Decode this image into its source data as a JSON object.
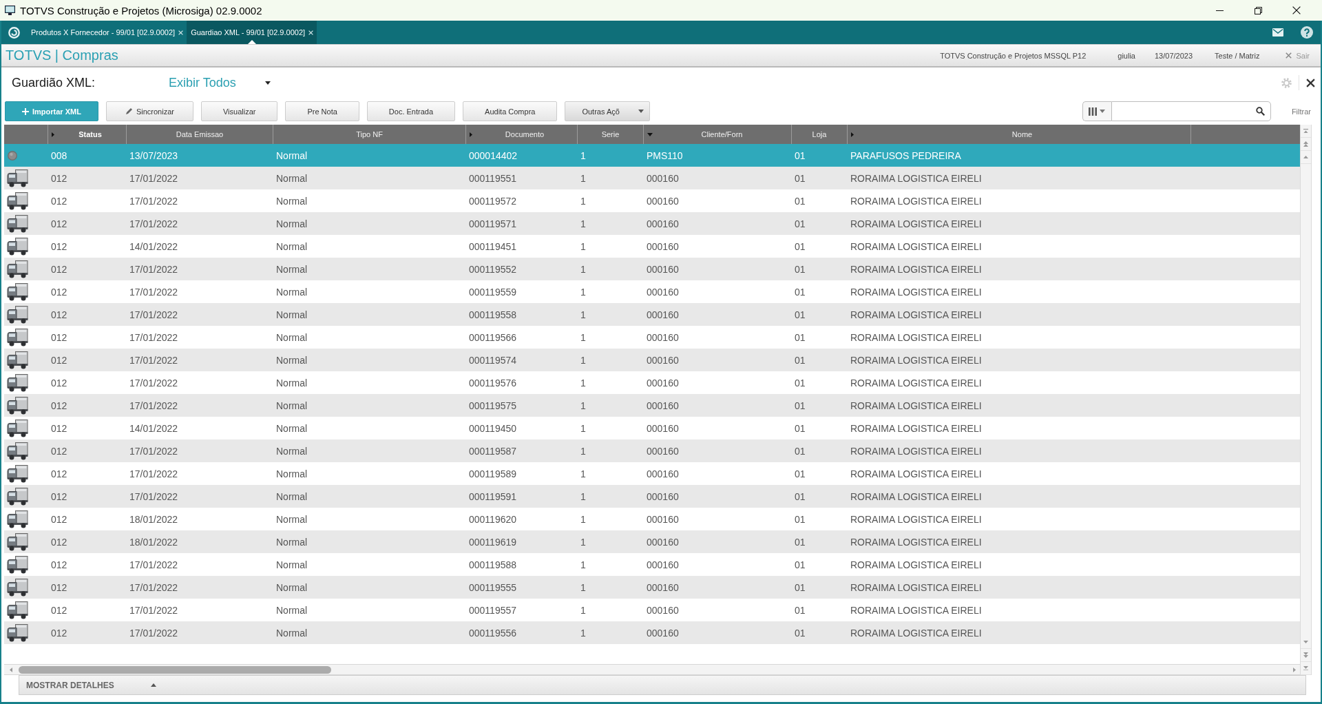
{
  "window": {
    "title": "TOTVS Construção e Projetos (Microsiga) 02.9.0002"
  },
  "tabs": [
    {
      "label": "Produtos X Fornecedor - 99/01 [02.9.0002]",
      "selected": false
    },
    {
      "label": "Guardiao XML - 99/01 [02.9.0002]",
      "selected": true
    }
  ],
  "header": {
    "brand": "TOTVS | Compras",
    "environment": "TOTVS Construção e Projetos MSSQL P12",
    "user": "giulia",
    "date": "13/07/2023",
    "branch": "Teste / Matriz",
    "exit": "Sair"
  },
  "page": {
    "title": "Guardião XML:",
    "view_filter": "Exibir Todos"
  },
  "toolbar": {
    "buttons": [
      {
        "label": "Importar XML",
        "kind": "primary"
      },
      {
        "label": "Sincronizar",
        "kind": "edit"
      },
      {
        "label": "Visualizar",
        "kind": "plain"
      },
      {
        "label": "Pre Nota",
        "kind": "plain"
      },
      {
        "label": "Doc. Entrada",
        "kind": "plain"
      },
      {
        "label": "Audita Compra",
        "kind": "plain"
      },
      {
        "label": "Outras Açõ",
        "kind": "menu"
      }
    ]
  },
  "search": {
    "filter_label": "Filtrar"
  },
  "table": {
    "columns": [
      {
        "label": "Status",
        "indexed": true,
        "sorted": false,
        "selected": true
      },
      {
        "label": "Data Emissao",
        "indexed": false,
        "sorted": false,
        "selected": false
      },
      {
        "label": "Tipo NF",
        "indexed": false,
        "sorted": false,
        "selected": false
      },
      {
        "label": "Documento",
        "indexed": true,
        "sorted": false,
        "selected": false
      },
      {
        "label": "Serie",
        "indexed": false,
        "sorted": false,
        "selected": false
      },
      {
        "label": "Cliente/Forn",
        "indexed": false,
        "sorted": true,
        "selected": false
      },
      {
        "label": "Loja",
        "indexed": false,
        "sorted": false,
        "selected": false
      },
      {
        "label": "Nome",
        "indexed": true,
        "sorted": false,
        "selected": false
      }
    ],
    "rows": [
      {
        "kind": "dot",
        "selected": true,
        "cells": [
          "008",
          "13/07/2023",
          "Normal",
          "000014402",
          "1",
          "PMS110",
          "01",
          "PARAFUSOS PEDREIRA"
        ]
      },
      {
        "kind": "truck",
        "selected": false,
        "cells": [
          "012",
          "17/01/2022",
          "Normal",
          "000119551",
          "1",
          "000160",
          "01",
          "RORAIMA LOGISTICA EIRELI"
        ]
      },
      {
        "kind": "truck",
        "selected": false,
        "cells": [
          "012",
          "17/01/2022",
          "Normal",
          "000119572",
          "1",
          "000160",
          "01",
          "RORAIMA LOGISTICA EIRELI"
        ]
      },
      {
        "kind": "truck",
        "selected": false,
        "cells": [
          "012",
          "17/01/2022",
          "Normal",
          "000119571",
          "1",
          "000160",
          "01",
          "RORAIMA LOGISTICA EIRELI"
        ]
      },
      {
        "kind": "truck",
        "selected": false,
        "cells": [
          "012",
          "14/01/2022",
          "Normal",
          "000119451",
          "1",
          "000160",
          "01",
          "RORAIMA LOGISTICA EIRELI"
        ]
      },
      {
        "kind": "truck",
        "selected": false,
        "cells": [
          "012",
          "17/01/2022",
          "Normal",
          "000119552",
          "1",
          "000160",
          "01",
          "RORAIMA LOGISTICA EIRELI"
        ]
      },
      {
        "kind": "truck",
        "selected": false,
        "cells": [
          "012",
          "17/01/2022",
          "Normal",
          "000119559",
          "1",
          "000160",
          "01",
          "RORAIMA LOGISTICA EIRELI"
        ]
      },
      {
        "kind": "truck",
        "selected": false,
        "cells": [
          "012",
          "17/01/2022",
          "Normal",
          "000119558",
          "1",
          "000160",
          "01",
          "RORAIMA LOGISTICA EIRELI"
        ]
      },
      {
        "kind": "truck",
        "selected": false,
        "cells": [
          "012",
          "17/01/2022",
          "Normal",
          "000119566",
          "1",
          "000160",
          "01",
          "RORAIMA LOGISTICA EIRELI"
        ]
      },
      {
        "kind": "truck",
        "selected": false,
        "cells": [
          "012",
          "17/01/2022",
          "Normal",
          "000119574",
          "1",
          "000160",
          "01",
          "RORAIMA LOGISTICA EIRELI"
        ]
      },
      {
        "kind": "truck",
        "selected": false,
        "cells": [
          "012",
          "17/01/2022",
          "Normal",
          "000119576",
          "1",
          "000160",
          "01",
          "RORAIMA LOGISTICA EIRELI"
        ]
      },
      {
        "kind": "truck",
        "selected": false,
        "cells": [
          "012",
          "17/01/2022",
          "Normal",
          "000119575",
          "1",
          "000160",
          "01",
          "RORAIMA LOGISTICA EIRELI"
        ]
      },
      {
        "kind": "truck",
        "selected": false,
        "cells": [
          "012",
          "14/01/2022",
          "Normal",
          "000119450",
          "1",
          "000160",
          "01",
          "RORAIMA LOGISTICA EIRELI"
        ]
      },
      {
        "kind": "truck",
        "selected": false,
        "cells": [
          "012",
          "17/01/2022",
          "Normal",
          "000119587",
          "1",
          "000160",
          "01",
          "RORAIMA LOGISTICA EIRELI"
        ]
      },
      {
        "kind": "truck",
        "selected": false,
        "cells": [
          "012",
          "17/01/2022",
          "Normal",
          "000119589",
          "1",
          "000160",
          "01",
          "RORAIMA LOGISTICA EIRELI"
        ]
      },
      {
        "kind": "truck",
        "selected": false,
        "cells": [
          "012",
          "17/01/2022",
          "Normal",
          "000119591",
          "1",
          "000160",
          "01",
          "RORAIMA LOGISTICA EIRELI"
        ]
      },
      {
        "kind": "truck",
        "selected": false,
        "cells": [
          "012",
          "18/01/2022",
          "Normal",
          "000119620",
          "1",
          "000160",
          "01",
          "RORAIMA LOGISTICA EIRELI"
        ]
      },
      {
        "kind": "truck",
        "selected": false,
        "cells": [
          "012",
          "18/01/2022",
          "Normal",
          "000119619",
          "1",
          "000160",
          "01",
          "RORAIMA LOGISTICA EIRELI"
        ]
      },
      {
        "kind": "truck",
        "selected": false,
        "cells": [
          "012",
          "17/01/2022",
          "Normal",
          "000119588",
          "1",
          "000160",
          "01",
          "RORAIMA LOGISTICA EIRELI"
        ]
      },
      {
        "kind": "truck",
        "selected": false,
        "cells": [
          "012",
          "17/01/2022",
          "Normal",
          "000119555",
          "1",
          "000160",
          "01",
          "RORAIMA LOGISTICA EIRELI"
        ]
      },
      {
        "kind": "truck",
        "selected": false,
        "cells": [
          "012",
          "17/01/2022",
          "Normal",
          "000119557",
          "1",
          "000160",
          "01",
          "RORAIMA LOGISTICA EIRELI"
        ]
      },
      {
        "kind": "truck",
        "selected": false,
        "cells": [
          "012",
          "17/01/2022",
          "Normal",
          "000119556",
          "1",
          "000160",
          "01",
          "RORAIMA LOGISTICA EIRELI"
        ]
      }
    ]
  },
  "details_bar": {
    "label": "MOSTRAR DETALHES",
    "expanded": false
  }
}
